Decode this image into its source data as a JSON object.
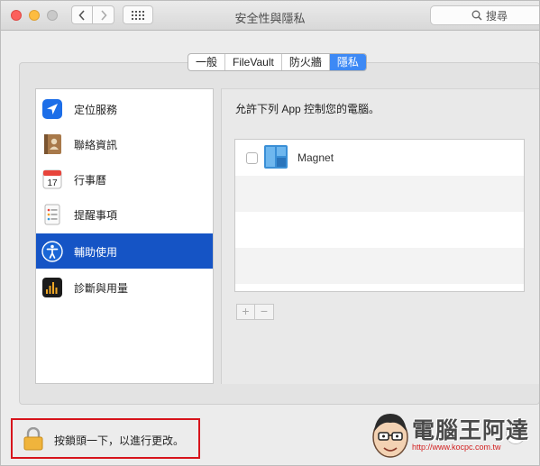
{
  "window": {
    "title": "安全性與隱私"
  },
  "search": {
    "label": "搜尋",
    "icon": "search-icon"
  },
  "tabs": [
    {
      "label": "一般",
      "active": false
    },
    {
      "label": "FileVault",
      "active": false
    },
    {
      "label": "防火牆",
      "active": false
    },
    {
      "label": "隱私",
      "active": true
    }
  ],
  "sidebar": {
    "items": [
      {
        "label": "定位服務",
        "icon": "location-arrow-icon",
        "selected": false
      },
      {
        "label": "聯絡資訊",
        "icon": "contacts-book-icon",
        "selected": false
      },
      {
        "label": "行事曆",
        "icon": "calendar-icon",
        "selected": false,
        "icon_text": "17"
      },
      {
        "label": "提醒事項",
        "icon": "reminders-list-icon",
        "selected": false
      },
      {
        "label": "輔助使用",
        "icon": "accessibility-icon",
        "selected": true
      },
      {
        "label": "診斷與用量",
        "icon": "diagnostics-icon",
        "selected": false
      }
    ]
  },
  "main": {
    "allow_label": "允許下列 App 控制您的電腦。",
    "apps": [
      {
        "name": "Magnet",
        "checked": false,
        "icon": "magnet-app-icon"
      }
    ],
    "add_label": "+",
    "remove_label": "−"
  },
  "footer": {
    "lock_text": "按鎖頭一下，以進行更改。",
    "lock_icon": "padlock-icon",
    "help_label": "?"
  },
  "watermark": {
    "brand": "電腦王阿達",
    "url": "http://www.kocpc.com.tw"
  },
  "colors": {
    "accent": "#3d89f5",
    "selection": "#1554c5",
    "highlight_box": "#d7141c"
  }
}
